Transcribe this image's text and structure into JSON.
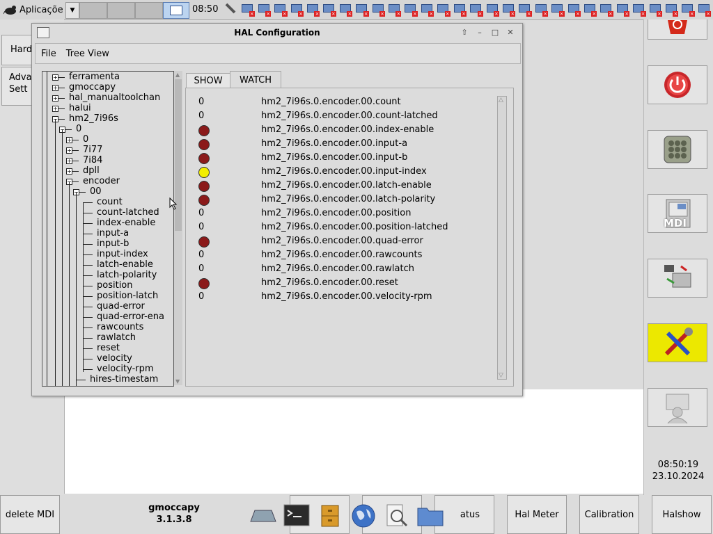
{
  "top_panel": {
    "app_menu_label": "Aplicaçõe",
    "clock": "08:50",
    "tray_icon": "network-disconnected-icon"
  },
  "left_buttons": [
    "Hard",
    "Adva\nSett"
  ],
  "hal_window": {
    "title": "HAL Configuration",
    "menu": [
      "File",
      "Tree View"
    ],
    "tabs": {
      "show": "SHOW",
      "watch": "WATCH"
    },
    "tree": [
      {
        "label": "ferramenta",
        "level": 0,
        "expander": "+"
      },
      {
        "label": "gmoccapy",
        "level": 0,
        "expander": "+"
      },
      {
        "label": "hal_manualtoolchan",
        "level": 0,
        "expander": "+"
      },
      {
        "label": "halui",
        "level": 0,
        "expander": "+"
      },
      {
        "label": "hm2_7i96s",
        "level": 0,
        "expander": "-"
      },
      {
        "label": "0",
        "level": 1,
        "expander": "-"
      },
      {
        "label": "0",
        "level": 2,
        "expander": "+"
      },
      {
        "label": "7i77",
        "level": 2,
        "expander": "+"
      },
      {
        "label": "7i84",
        "level": 2,
        "expander": "+"
      },
      {
        "label": "dpll",
        "level": 2,
        "expander": "+"
      },
      {
        "label": "encoder",
        "level": 2,
        "expander": "-"
      },
      {
        "label": "00",
        "level": 3,
        "expander": "-"
      },
      {
        "label": "count",
        "level": 4,
        "expander": ""
      },
      {
        "label": "count-latched",
        "level": 4,
        "expander": ""
      },
      {
        "label": "index-enable",
        "level": 4,
        "expander": ""
      },
      {
        "label": "input-a",
        "level": 4,
        "expander": ""
      },
      {
        "label": "input-b",
        "level": 4,
        "expander": ""
      },
      {
        "label": "input-index",
        "level": 4,
        "expander": ""
      },
      {
        "label": "latch-enable",
        "level": 4,
        "expander": ""
      },
      {
        "label": "latch-polarity",
        "level": 4,
        "expander": ""
      },
      {
        "label": "position",
        "level": 4,
        "expander": ""
      },
      {
        "label": "position-latch",
        "level": 4,
        "expander": ""
      },
      {
        "label": "quad-error",
        "level": 4,
        "expander": ""
      },
      {
        "label": "quad-error-ena",
        "level": 4,
        "expander": ""
      },
      {
        "label": "rawcounts",
        "level": 4,
        "expander": ""
      },
      {
        "label": "rawlatch",
        "level": 4,
        "expander": ""
      },
      {
        "label": "reset",
        "level": 4,
        "expander": ""
      },
      {
        "label": "velocity",
        "level": 4,
        "expander": ""
      },
      {
        "label": "velocity-rpm",
        "level": 4,
        "expander": ""
      },
      {
        "label": "hires-timestam",
        "level": 3,
        "expander": ""
      }
    ],
    "watch": [
      {
        "type": "value",
        "value": "0",
        "name": "hm2_7i96s.0.encoder.00.count"
      },
      {
        "type": "value",
        "value": "0",
        "name": "hm2_7i96s.0.encoder.00.count-latched"
      },
      {
        "type": "led",
        "state": "off",
        "name": "hm2_7i96s.0.encoder.00.index-enable"
      },
      {
        "type": "led",
        "state": "off",
        "name": "hm2_7i96s.0.encoder.00.input-a"
      },
      {
        "type": "led",
        "state": "off",
        "name": "hm2_7i96s.0.encoder.00.input-b"
      },
      {
        "type": "led",
        "state": "on",
        "name": "hm2_7i96s.0.encoder.00.input-index"
      },
      {
        "type": "led",
        "state": "off",
        "name": "hm2_7i96s.0.encoder.00.latch-enable"
      },
      {
        "type": "led",
        "state": "off",
        "name": "hm2_7i96s.0.encoder.00.latch-polarity"
      },
      {
        "type": "value",
        "value": "0",
        "name": "hm2_7i96s.0.encoder.00.position"
      },
      {
        "type": "value",
        "value": "0",
        "name": "hm2_7i96s.0.encoder.00.position-latched"
      },
      {
        "type": "led",
        "state": "off",
        "name": "hm2_7i96s.0.encoder.00.quad-error"
      },
      {
        "type": "value",
        "value": "0",
        "name": "hm2_7i96s.0.encoder.00.rawcounts"
      },
      {
        "type": "value",
        "value": "0",
        "name": "hm2_7i96s.0.encoder.00.rawlatch"
      },
      {
        "type": "led",
        "state": "off",
        "name": "hm2_7i96s.0.encoder.00.reset"
      },
      {
        "type": "value",
        "value": "0",
        "name": "hm2_7i96s.0.encoder.00.velocity-rpm"
      }
    ],
    "colors": {
      "led_off": "#8b1a1a",
      "led_on": "#f2ee00"
    }
  },
  "right_panel": {
    "icons": [
      "estop-icon",
      "power-icon",
      "keypad-icon",
      "mdi-icon",
      "machine-icon",
      "tools-icon",
      "user-icon"
    ],
    "mdi_label": "MDI",
    "time": "08:50:19",
    "date": "23.10.2024",
    "tools_color": "#ece800"
  },
  "bottom_bar": {
    "delete_mdi": "delete MDI",
    "app_name": "gmoccapy",
    "version": "3.1.3.8",
    "status_partial": "atus",
    "hal_meter": "Hal Meter",
    "calibration": "Calibration",
    "halshow": "Halshow",
    "dock_icons": [
      "window-icon",
      "terminal-icon",
      "file-cabinet-icon",
      "globe-icon",
      "search-icon",
      "folder-icon"
    ]
  }
}
